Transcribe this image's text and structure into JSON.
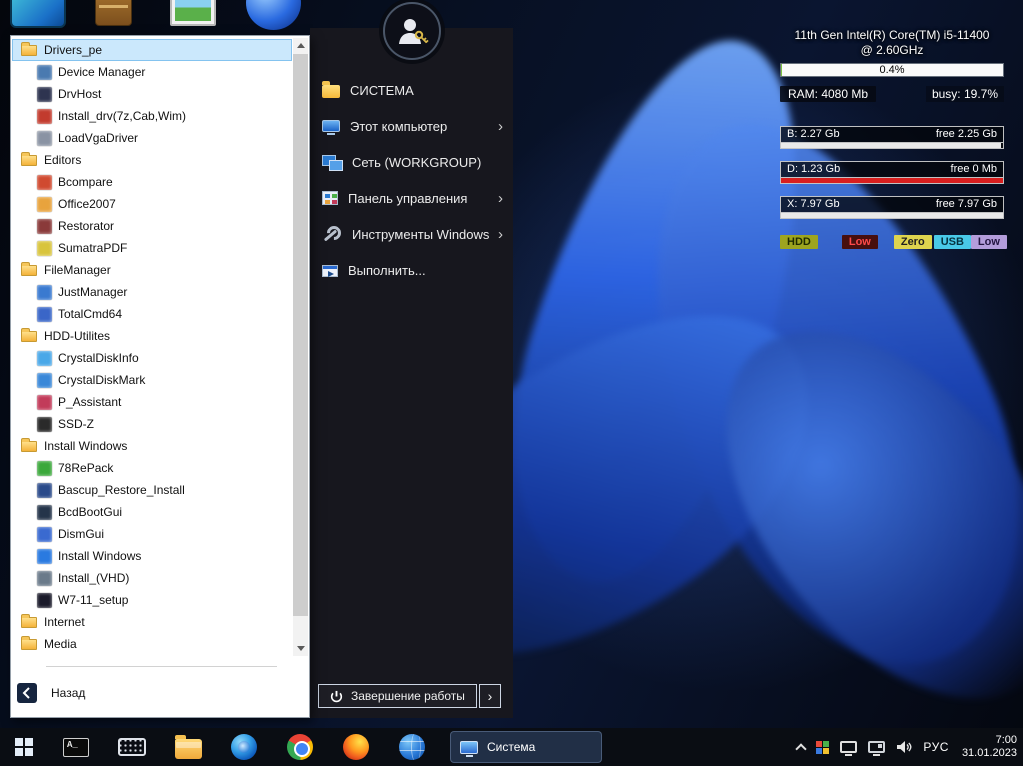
{
  "system_monitor": {
    "cpu_name_line1": "11th Gen Intel(R) Core(TM) i5-11400",
    "cpu_name_line2": "@ 2.60GHz",
    "cpu_load_text": "0.4%",
    "cpu_load_pct": 0.4,
    "ram_text": "RAM: 4080 Mb",
    "busy_text": "busy: 19.7%",
    "drives": [
      {
        "label": "B:   2.27 Gb",
        "free": "free 2.25 Gb",
        "pct": 99,
        "color": "#e9e9e9"
      },
      {
        "label": "D:   1.23 Gb",
        "free": "free 0 Mb",
        "pct": 100,
        "color": "#d81f1f"
      },
      {
        "label": "X:   7.97 Gb",
        "free": "free 7.97 Gb",
        "pct": 100,
        "color": "#e9e9e9"
      }
    ],
    "indicators": [
      {
        "label": "HDD",
        "bg": "#9ea51f",
        "fg": "#1e2a00"
      },
      {
        "label": "Low",
        "bg": "#470f0f",
        "fg": "#ff4a4a"
      },
      {
        "label": "Zero",
        "bg": "#ded44e",
        "fg": "#1f1f1f"
      },
      {
        "label": "USB",
        "bg": "#49c9e8",
        "fg": "#06323f"
      },
      {
        "label": "Low",
        "bg": "#b39ddb",
        "fg": "#231541"
      }
    ]
  },
  "start_menu": {
    "left_panel": {
      "items": [
        {
          "label": "Drivers_pe",
          "type": "folder",
          "selected": true
        },
        {
          "label": "Device Manager",
          "type": "app",
          "color": "#4a7ab0"
        },
        {
          "label": "DrvHost",
          "type": "app",
          "color": "#2e3450"
        },
        {
          "label": "Install_drv(7z,Cab,Wim)",
          "type": "app",
          "color": "#c23b2e"
        },
        {
          "label": "LoadVgaDriver",
          "type": "app",
          "color": "#8a93a3"
        },
        {
          "label": "Editors",
          "type": "folder"
        },
        {
          "label": "Bcompare",
          "type": "app",
          "color": "#d04a30"
        },
        {
          "label": "Office2007",
          "type": "app",
          "color": "#e8a33d"
        },
        {
          "label": "Restorator",
          "type": "app",
          "color": "#8a3a3a"
        },
        {
          "label": "SumatraPDF",
          "type": "app",
          "color": "#d8c43d"
        },
        {
          "label": "FileManager",
          "type": "folder"
        },
        {
          "label": "JustManager",
          "type": "app",
          "color": "#3a7ad0"
        },
        {
          "label": "TotalCmd64",
          "type": "app",
          "color": "#3a66c8"
        },
        {
          "label": "HDD-Utilites",
          "type": "folder"
        },
        {
          "label": "CrystalDiskInfo",
          "type": "app",
          "color": "#4aa8e8"
        },
        {
          "label": "CrystalDiskMark",
          "type": "app",
          "color": "#3a88d8"
        },
        {
          "label": "P_Assistant",
          "type": "app",
          "color": "#c23b5a"
        },
        {
          "label": "SSD-Z",
          "type": "app",
          "color": "#2a2a2a"
        },
        {
          "label": "Install Windows",
          "type": "folder"
        },
        {
          "label": "78RePack",
          "type": "app",
          "color": "#3ba83b"
        },
        {
          "label": "Bascup_Restore_Install",
          "type": "app",
          "color": "#2a4a8a"
        },
        {
          "label": "BcdBootGui",
          "type": "app",
          "color": "#24344a"
        },
        {
          "label": "DismGui",
          "type": "app",
          "color": "#3a6ad0"
        },
        {
          "label": "Install Windows",
          "type": "app",
          "color": "#2a7ae0"
        },
        {
          "label": "Install_(VHD)",
          "type": "app",
          "color": "#6a7a8a"
        },
        {
          "label": "W7-11_setup",
          "type": "app",
          "color": "#1a1a2a"
        },
        {
          "label": "Internet",
          "type": "folder"
        },
        {
          "label": "Media",
          "type": "folder"
        }
      ],
      "back_label": "Назад"
    },
    "right_panel": {
      "items": [
        {
          "label": "СИСТЕМА",
          "icon": "folder",
          "chevron": false
        },
        {
          "label": "Этот компьютер",
          "icon": "computer",
          "chevron": true
        },
        {
          "label": "Сеть (WORKGROUP)",
          "icon": "network",
          "chevron": false
        },
        {
          "label": "Панель управления",
          "icon": "control-panel",
          "chevron": true
        },
        {
          "label": "Инструменты Windows",
          "icon": "tools",
          "chevron": true
        },
        {
          "label": "Выполнить...",
          "icon": "run",
          "chevron": false
        }
      ],
      "shutdown_label": "Завершение работы"
    }
  },
  "taskbar": {
    "cmd_glyph": "A_",
    "app_window": {
      "label": "Система"
    },
    "tray": {
      "language": "РУС",
      "time": "7:00",
      "date": "31.01.2023"
    }
  },
  "icons": {
    "taskbar": [
      "windows-start",
      "cmd-console",
      "on-screen-keyboard",
      "file-explorer",
      "edge-browser",
      "chrome-browser",
      "firefox-browser",
      "network-globe"
    ],
    "tray": [
      "tray-expand",
      "hardware",
      "display",
      "display-settings",
      "volume"
    ],
    "desktop": [
      "pc-monitor",
      "briefcase",
      "pictures",
      "blue-sphere"
    ]
  },
  "colors": {
    "selection_bg": "#cbe8fc",
    "menu_panel_dark": "#17171e",
    "taskbar_bg": "#0a0d13"
  }
}
